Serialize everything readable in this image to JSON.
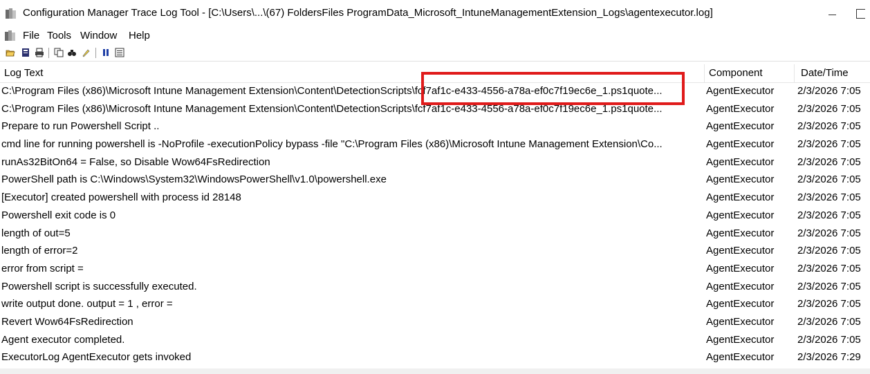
{
  "window": {
    "title": "Configuration Manager Trace Log Tool - [C:\\Users\\...\\(67) FoldersFiles ProgramData_Microsoft_IntuneManagementExtension_Logs\\agentexecutor.log]"
  },
  "menu": {
    "items": [
      "File",
      "Tools",
      "Window",
      "Help"
    ]
  },
  "toolbar": {
    "icons": [
      "open-icon",
      "print-preview-icon",
      "print-icon",
      "copy-icon",
      "find-icon",
      "highlight-icon",
      "pause-icon",
      "list-icon"
    ]
  },
  "table": {
    "columns": [
      "Log Text",
      "Component",
      "Date/Time"
    ],
    "rows": [
      {
        "text": "C:\\Program Files (x86)\\Microsoft Intune Management Extension\\Content\\DetectionScripts\\fcf7af1c-e433-4556-a78a-ef0c7f19ec6e_1.ps1quote...",
        "component": "AgentExecutor",
        "datetime": "2/3/2026 7:05"
      },
      {
        "text": "C:\\Program Files (x86)\\Microsoft Intune Management Extension\\Content\\DetectionScripts\\fcf7af1c-e433-4556-a78a-ef0c7f19ec6e_1.ps1quote...",
        "component": "AgentExecutor",
        "datetime": "2/3/2026 7:05"
      },
      {
        "text": "Prepare to run Powershell Script ..",
        "component": "AgentExecutor",
        "datetime": "2/3/2026 7:05"
      },
      {
        "text": "cmd line for running powershell is -NoProfile -executionPolicy bypass -file  \"C:\\Program Files (x86)\\Microsoft Intune Management Extension\\Co...",
        "component": "AgentExecutor",
        "datetime": "2/3/2026 7:05"
      },
      {
        "text": "runAs32BitOn64 = False, so Disable Wow64FsRedirection",
        "component": "AgentExecutor",
        "datetime": "2/3/2026 7:05"
      },
      {
        "text": "PowerShell path is C:\\Windows\\System32\\WindowsPowerShell\\v1.0\\powershell.exe",
        "component": "AgentExecutor",
        "datetime": "2/3/2026 7:05"
      },
      {
        "text": "[Executor] created powershell with process id 28148",
        "component": "AgentExecutor",
        "datetime": "2/3/2026 7:05"
      },
      {
        "text": "Powershell exit code is 0",
        "component": "AgentExecutor",
        "datetime": "2/3/2026 7:05"
      },
      {
        "text": "length of out=5",
        "component": "AgentExecutor",
        "datetime": "2/3/2026 7:05"
      },
      {
        "text": "length of error=2",
        "component": "AgentExecutor",
        "datetime": "2/3/2026 7:05"
      },
      {
        "text": "error from script =",
        "component": "AgentExecutor",
        "datetime": "2/3/2026 7:05"
      },
      {
        "text": "Powershell script is successfully executed.",
        "component": "AgentExecutor",
        "datetime": "2/3/2026 7:05"
      },
      {
        "text": "write output done. output = 1 , error =",
        "component": "AgentExecutor",
        "datetime": "2/3/2026 7:05"
      },
      {
        "text": "Revert Wow64FsRedirection",
        "component": "AgentExecutor",
        "datetime": "2/3/2026 7:05"
      },
      {
        "text": "Agent executor completed.",
        "component": "AgentExecutor",
        "datetime": "2/3/2026 7:05"
      },
      {
        "text": "ExecutorLog AgentExecutor gets invoked",
        "component": "AgentExecutor",
        "datetime": "2/3/2026 7:29"
      }
    ]
  },
  "annotation": {
    "highlight_color": "#e01b1b"
  }
}
